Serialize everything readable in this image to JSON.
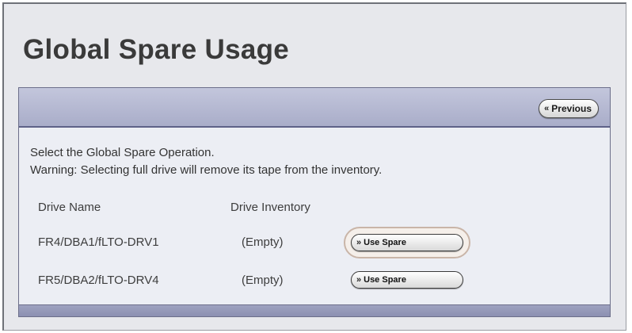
{
  "page": {
    "title": "Global Spare Usage"
  },
  "header": {
    "previous_label": "Previous",
    "previous_icon": "double-chevron-left-icon"
  },
  "body": {
    "instruction": "Select the Global Spare Operation.",
    "warning": "Warning: Selecting full drive will remove its tape from the inventory.",
    "columns": [
      "Drive Name",
      "Drive Inventory"
    ],
    "rows": [
      {
        "drive_name": "FR4/DBA1/fLTO-DRV1",
        "inventory": "(Empty)",
        "action": "Use Spare",
        "highlighted": true
      },
      {
        "drive_name": "FR5/DBA2/fLTO-DRV4",
        "inventory": "(Empty)",
        "action": "Use Spare",
        "highlighted": false
      }
    ],
    "action_icon": "double-chevron-right-icon"
  },
  "colors": {
    "header_bg": "#aeb2cc",
    "panel_bg": "#eceef4",
    "page_bg": "#e7e8ec",
    "highlight_ring": "#c9b5a8"
  }
}
